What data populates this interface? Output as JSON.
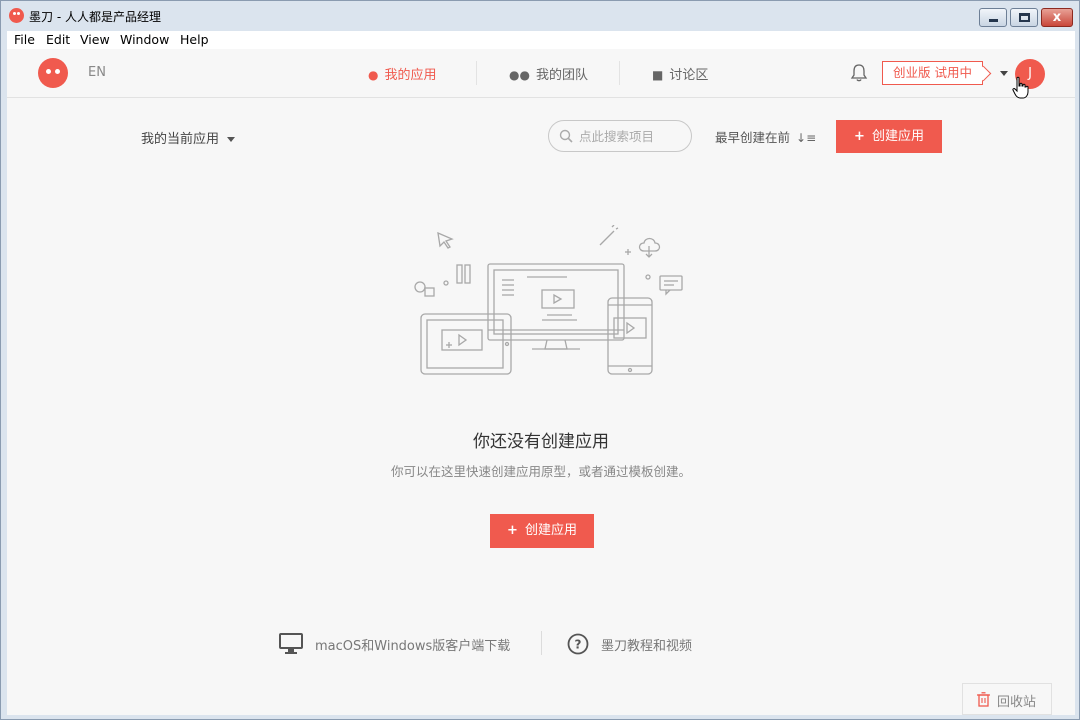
{
  "window": {
    "title": "墨刀 - 人人都是产品经理",
    "controls": {
      "close": "x"
    }
  },
  "menubar": [
    "File",
    "Edit",
    "View",
    "Window",
    "Help"
  ],
  "header": {
    "lang": "EN",
    "nav": [
      {
        "label": "我的应用",
        "icon": "user-icon",
        "active": true
      },
      {
        "label": "我的团队",
        "icon": "team-icon",
        "active": false
      },
      {
        "label": "讨论区",
        "icon": "chat-icon",
        "active": false
      }
    ],
    "trial_badge": "创业版 试用中",
    "avatar_letter": "J"
  },
  "toolbar": {
    "filter_label": "我的当前应用",
    "search_placeholder": "点此搜索项目",
    "sort_label": "最早创建在前",
    "create_button": "创建应用"
  },
  "empty_state": {
    "title": "你还没有创建应用",
    "description": "你可以在这里快速创建应用原型，或者通过模板创建。",
    "create_button": "创建应用"
  },
  "footer": {
    "download_link": "macOS和Windows版客户端下载",
    "tutorial_link": "墨刀教程和视频",
    "trash_label": "回收站"
  },
  "colors": {
    "accent": "#f05a4e",
    "background": "#f7f7f7",
    "text": "#333333",
    "muted": "#888888"
  }
}
